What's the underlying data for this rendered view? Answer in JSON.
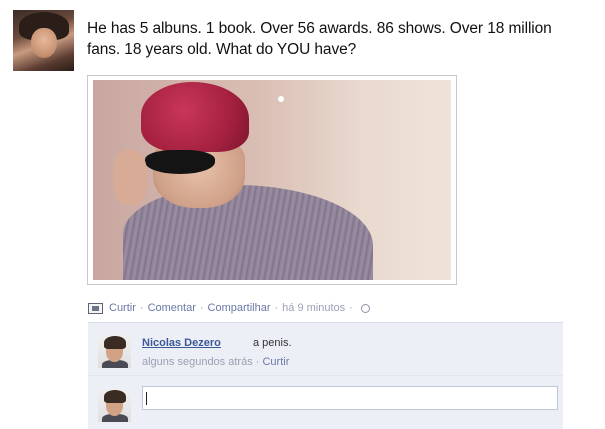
{
  "post": {
    "text": "He has 5 albuns. 1 book. Over 56 awards. 86 shows. Over 18 million fans. 18 years old. What do YOU have?"
  },
  "actions": {
    "like": "Curtir",
    "comment": "Comentar",
    "share": "Compartilhar",
    "time": "há 9 minutos",
    "separator": "·"
  },
  "comment": {
    "author": "Nicolas Dezero",
    "text": "a penis.",
    "time": "alguns segundos atrás",
    "like": "Curtir"
  },
  "reply": {
    "value": ""
  },
  "colors": {
    "link": "#3b5998",
    "comment_bg": "#eceff5",
    "meta": "#9aa0b3"
  }
}
